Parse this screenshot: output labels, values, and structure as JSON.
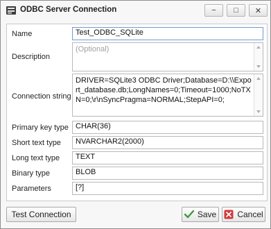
{
  "window": {
    "title": "ODBC Server Connection",
    "controls": {
      "minimize": "−",
      "maximize": "□",
      "close": "✕"
    }
  },
  "form": {
    "name": {
      "label": "Name",
      "value": "Test_ODBC_SQLite"
    },
    "description": {
      "label": "Description",
      "placeholder": "(Optional)",
      "value": ""
    },
    "connection_string": {
      "label": "Connection string",
      "value": "DRIVER=SQLite3 ODBC Driver;Database=D:\\\\Export_database.db;LongNames=0;Timeout=1000;NoTXN=0;\\r\\nSyncPragma=NORMAL;StepAPI=0;"
    },
    "primary_key_type": {
      "label": "Primary key type",
      "value": "CHAR(36)"
    },
    "short_text_type": {
      "label": "Short text type",
      "value": "NVARCHAR2(2000)"
    },
    "long_text_type": {
      "label": "Long text type",
      "value": "TEXT"
    },
    "binary_type": {
      "label": "Binary type",
      "value": "BLOB"
    },
    "parameters": {
      "label": "Parameters",
      "value": "[?]"
    }
  },
  "buttons": {
    "test_connection": "Test Connection",
    "save": "Save",
    "cancel": "Cancel"
  },
  "colors": {
    "save_check": "#3c9a3c",
    "cancel_x": "#d23a3a",
    "accent_border": "#b8b8b8"
  }
}
